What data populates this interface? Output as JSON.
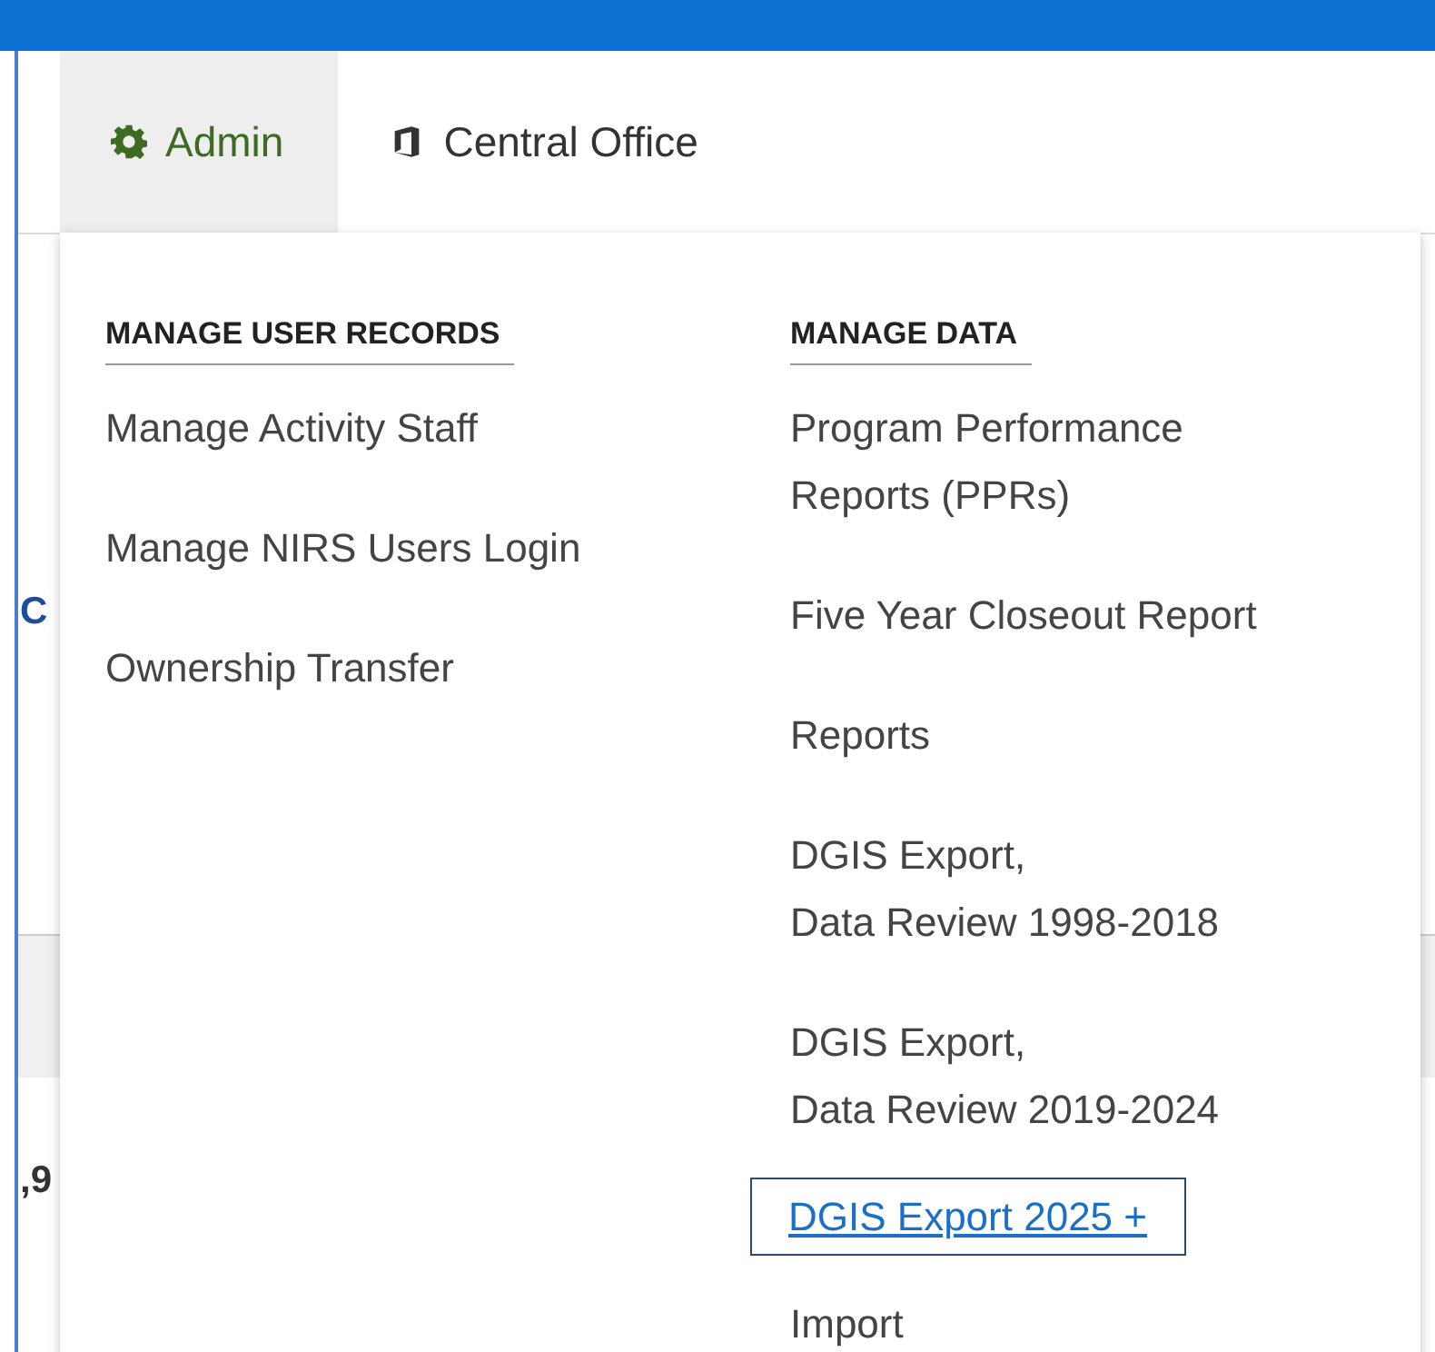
{
  "nav": [
    {
      "label": "Admin",
      "kind": "gear",
      "selected": true
    },
    {
      "label": "Central Office",
      "kind": "office",
      "selected": false
    }
  ],
  "background": {
    "left_texts": [
      "C",
      ",9"
    ]
  },
  "menu": {
    "columns": [
      {
        "heading": "MANAGE USER RECORDS",
        "items": [
          {
            "label": "Manage Activity Staff",
            "selected": false
          },
          {
            "label": "Manage NIRS Users Login",
            "selected": false
          },
          {
            "label": "Ownership Transfer",
            "selected": false
          }
        ]
      },
      {
        "heading": "MANAGE DATA",
        "items": [
          {
            "label": "Program Performance\nReports (PPRs)",
            "selected": false
          },
          {
            "label": "Five Year Closeout Report",
            "selected": false
          },
          {
            "label": "Reports",
            "selected": false
          },
          {
            "label": "DGIS Export,\nData Review 1998-2018",
            "selected": false
          },
          {
            "label": "DGIS Export,\nData Review 2019-2024",
            "selected": false
          },
          {
            "label": "DGIS Export 2025 +",
            "selected": true
          },
          {
            "label": "Import",
            "selected": false
          }
        ]
      }
    ]
  }
}
